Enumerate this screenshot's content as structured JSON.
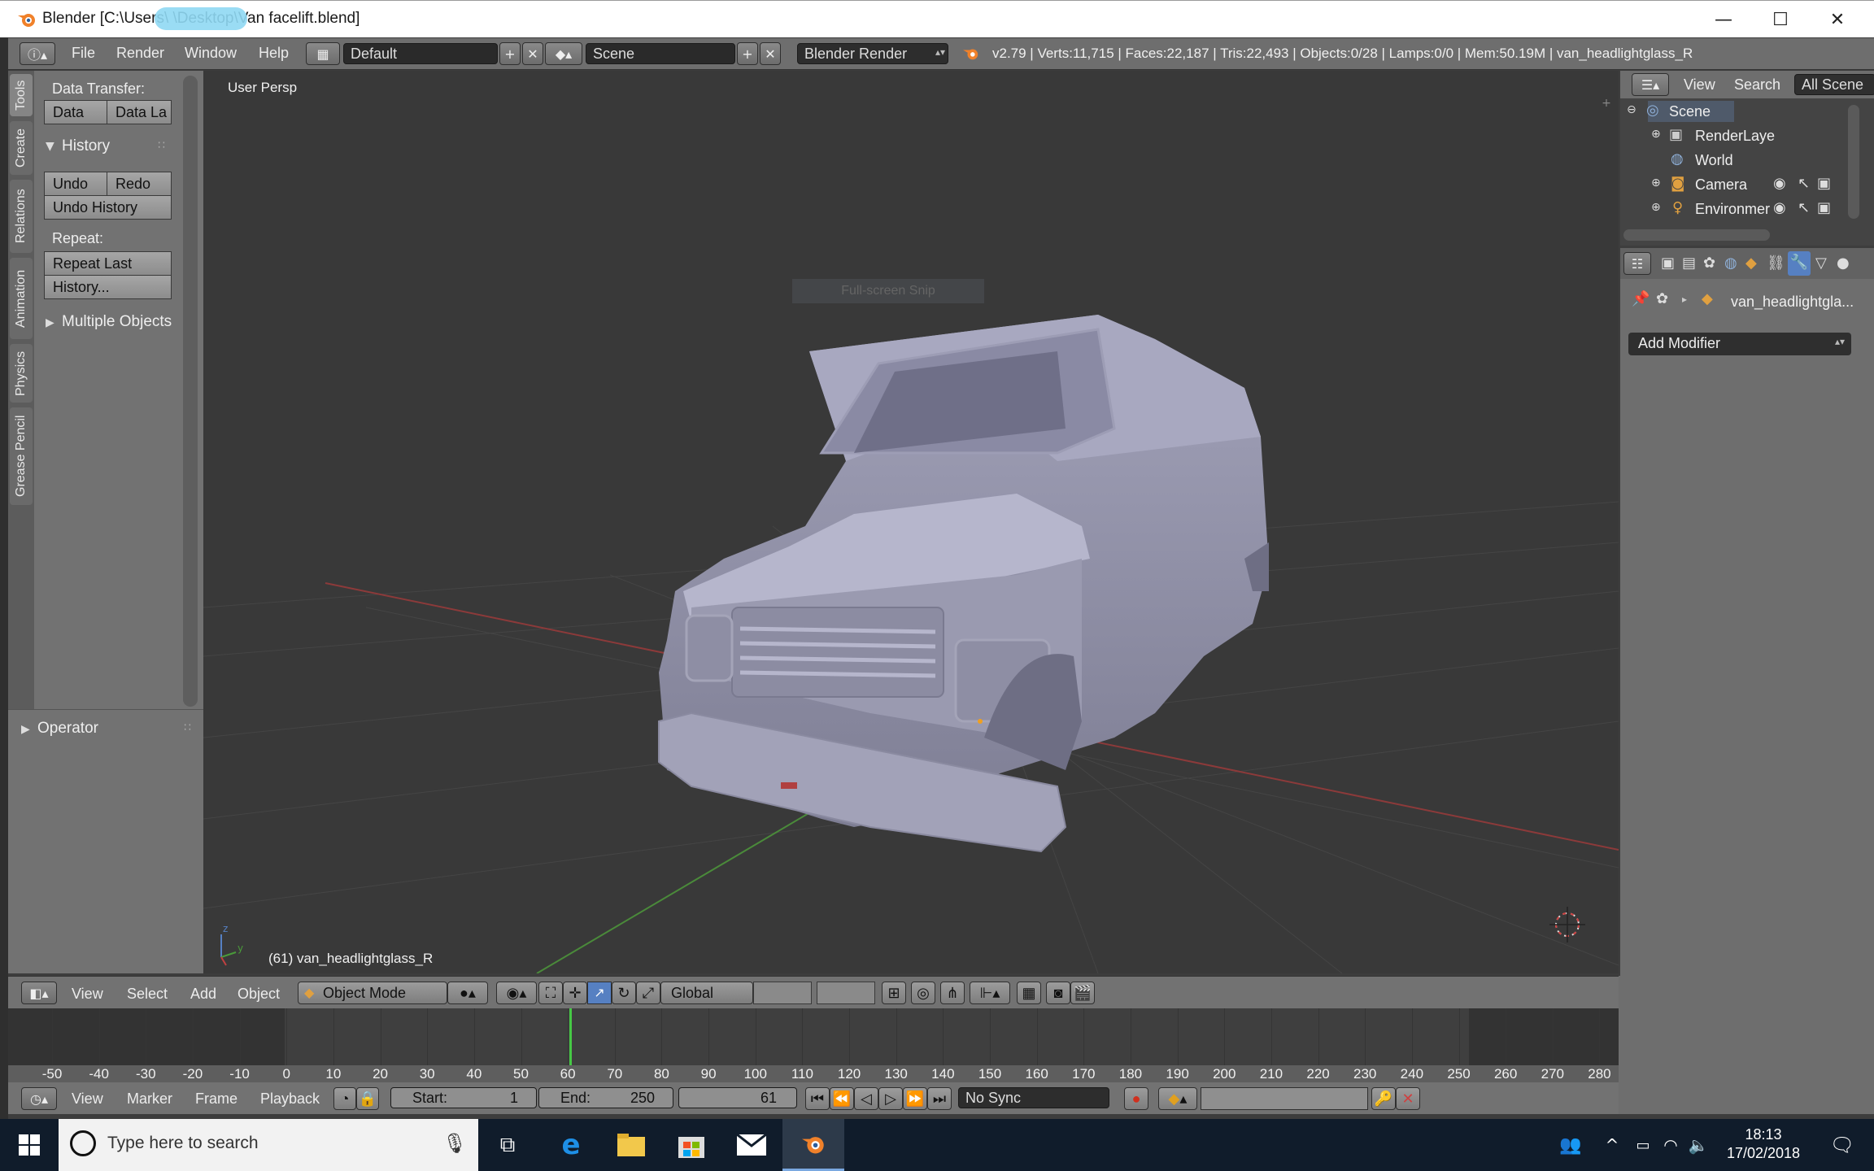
{
  "window": {
    "title": "Blender [C:\\Users\\ \\Desktop\\Van facelift.blend]",
    "minimize": "—",
    "maximize": "☐",
    "close": "✕"
  },
  "topbar": {
    "menus": [
      "File",
      "Render",
      "Window",
      "Help"
    ],
    "layout": "Default",
    "scene": "Scene",
    "engine": "Blender Render",
    "stats": "v2.79 | Verts:11,715 | Faces:22,187 | Tris:22,493 | Objects:0/28 | Lamps:0/0 | Mem:50.19M | van_headlightglass_R"
  },
  "tool_tabs": [
    "Tools",
    "Create",
    "Relations",
    "Animation",
    "Physics",
    "Grease Pencil"
  ],
  "tool_panel": {
    "data_transfer_label": "Data Transfer:",
    "data_btn": "Data",
    "data_layers_btn": "Data La",
    "history_header": "History",
    "undo": "Undo",
    "redo": "Redo",
    "undo_history": "Undo History",
    "repeat_label": "Repeat:",
    "repeat_last": "Repeat Last",
    "history_btn": "History...",
    "multiple_objects": "Multiple Objects",
    "operator_header": "Operator"
  },
  "viewport": {
    "view_name": "User Persp",
    "object_label": "(61) van_headlightglass_R",
    "snip_label": "Full-screen Snip",
    "axis_z": "z",
    "axis_y": "y"
  },
  "outliner": {
    "view": "View",
    "search": "Search",
    "all_scenes": "All Scene",
    "items": [
      "Scene",
      "RenderLaye",
      "World",
      "Camera",
      "Environmer"
    ]
  },
  "properties": {
    "object_name": "van_headlightgla...",
    "add_modifier": "Add Modifier"
  },
  "view3d_header": {
    "menus": [
      "View",
      "Select",
      "Add",
      "Object"
    ],
    "mode": "Object Mode",
    "orientation": "Global"
  },
  "timeline": {
    "ruler": [
      "-50",
      "-40",
      "-30",
      "-20",
      "-10",
      "0",
      "10",
      "20",
      "30",
      "40",
      "50",
      "60",
      "70",
      "80",
      "90",
      "100",
      "110",
      "120",
      "130",
      "140",
      "150",
      "160",
      "170",
      "180",
      "190",
      "200",
      "210",
      "220",
      "230",
      "240",
      "250",
      "260",
      "270",
      "280"
    ],
    "current_frame_marker": 60
  },
  "timeline_header": {
    "menus": [
      "View",
      "Marker",
      "Frame",
      "Playback"
    ],
    "start_label": "Start:",
    "start": "1",
    "end_label": "End:",
    "end": "250",
    "current": "61",
    "sync": "No Sync"
  },
  "taskbar": {
    "search_placeholder": "Type here to search",
    "time": "18:13",
    "date": "17/02/2018"
  },
  "colors": {
    "accent_blue": "#5680c2",
    "timeline_marker": "#46c845",
    "taskbar": "#101c2b",
    "blender_orange": "#f0812a"
  }
}
